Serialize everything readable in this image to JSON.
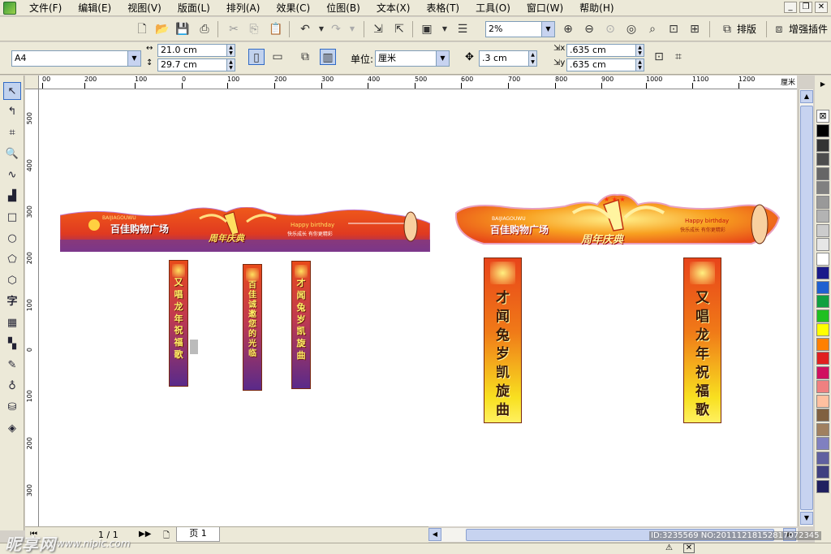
{
  "menu": [
    "文件(F)",
    "编辑(E)",
    "视图(V)",
    "版面(L)",
    "排列(A)",
    "效果(C)",
    "位图(B)",
    "文本(X)",
    "表格(T)",
    "工具(O)",
    "窗口(W)",
    "帮助(H)"
  ],
  "toolbar": {
    "zoom": "2%",
    "layout_label": "排版",
    "plugin_label": "增强插件"
  },
  "property_bar": {
    "paper_size": "A4",
    "width": "21.0 cm",
    "height": "29.7 cm",
    "units_label": "单位:",
    "units_value": "厘米",
    "nudge": ".3 cm",
    "dup_x": ".635 cm",
    "dup_y": ".635 cm"
  },
  "ruler": {
    "h_ticks": [
      "00",
      "200",
      "100",
      "0",
      "100",
      "200",
      "300",
      "400",
      "500",
      "600",
      "700",
      "800",
      "900",
      "1000",
      "1100",
      "1200"
    ],
    "v_ticks": [
      "500",
      "400",
      "300",
      "200",
      "100",
      "0",
      "100",
      "200",
      "300"
    ],
    "unit": "厘米"
  },
  "artwork": {
    "brand_pinyin": "BAIJIAGOUWU",
    "brand": "百佳购物广场",
    "celebration": "周年庆典",
    "anniversary_number": "1",
    "birthday_en": "Happy birthday",
    "slogan": "快乐成长 有你更精彩",
    "strips": [
      {
        "text": "又唱龙年祝福歌",
        "style": "purple"
      },
      {
        "text": "百佳诚邀您的光临",
        "style": "purple"
      },
      {
        "text": "才闻兔岁凯旋曲",
        "style": "purple"
      },
      {
        "text": "才闻兔岁凯旋曲",
        "style": "yellow"
      },
      {
        "text": "又唱龙年祝福歌",
        "style": "yellow"
      }
    ]
  },
  "pagebar": {
    "page_count": "1 / 1",
    "page_tab": "页 1"
  },
  "watermark": {
    "logo": "昵享网",
    "url": "www.nipic.com",
    "id": "ID:3235569 NO:20111218152817072345"
  },
  "palette_colors": [
    "#000000",
    "#333333",
    "#4d4d4d",
    "#666666",
    "#808080",
    "#999999",
    "#b3b3b3",
    "#cccccc",
    "#e6e6e6",
    "#ffffff",
    "#1a1a8a",
    "#2060d0",
    "#10a040",
    "#20c020",
    "#ffff00",
    "#ff8000",
    "#e02020",
    "#d01060",
    "#f08080",
    "#ffc0a0",
    "#806040",
    "#a08060",
    "#8080c0",
    "#6060a0",
    "#404080",
    "#202060"
  ]
}
